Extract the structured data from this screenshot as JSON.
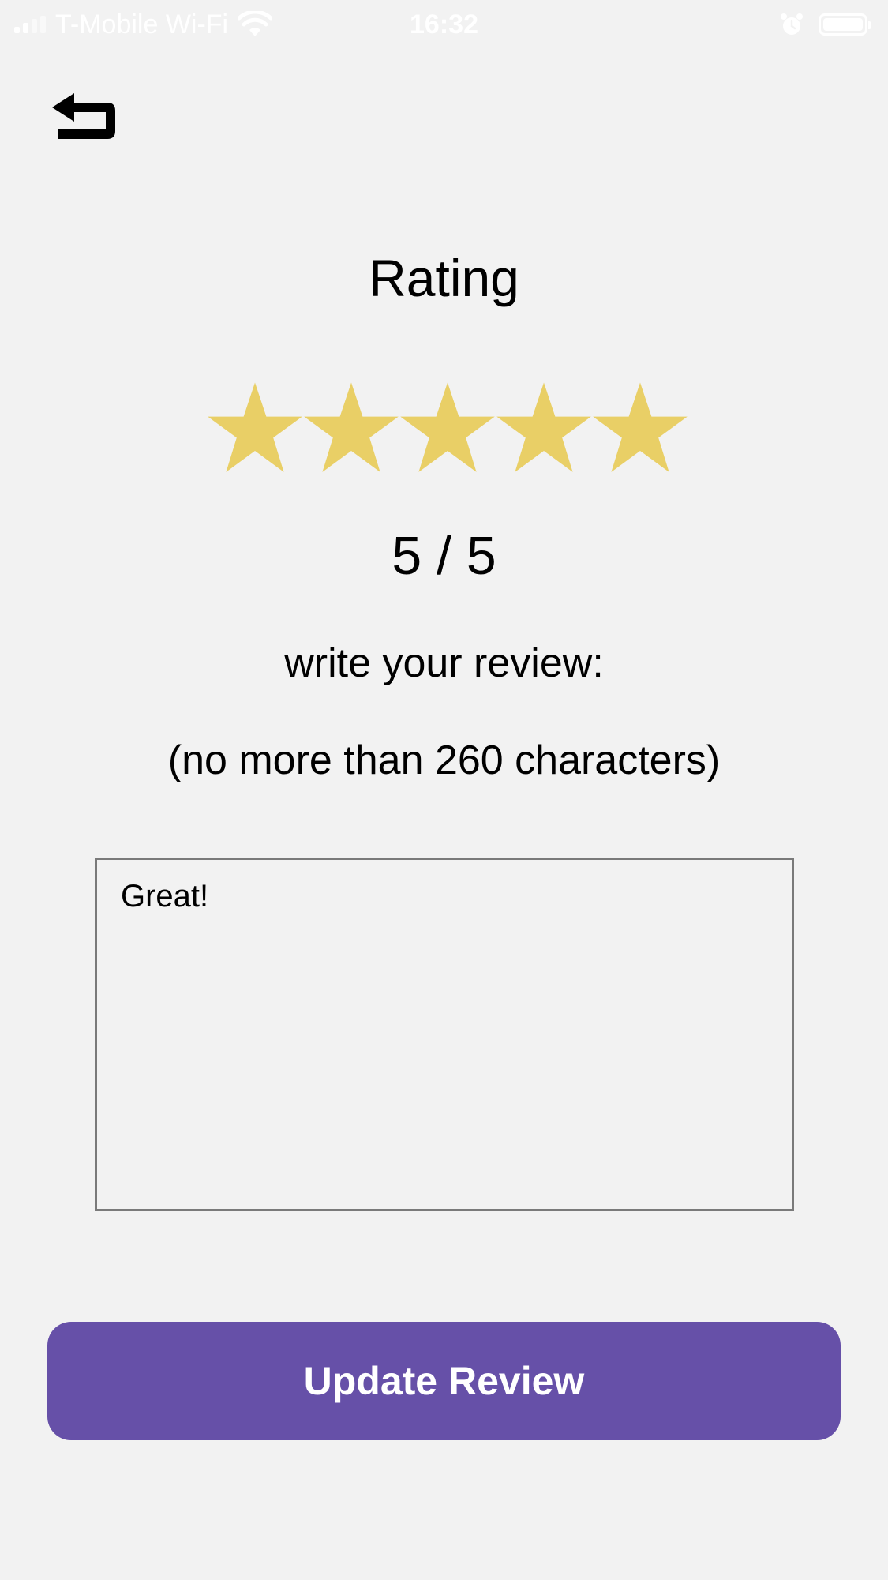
{
  "status_bar": {
    "carrier": "T-Mobile Wi-Fi",
    "time": "16:32",
    "signal_bars_filled": 2,
    "signal_bars_total": 4,
    "battery_level": 1.0
  },
  "header": {
    "back_icon": "return-arrow-icon"
  },
  "rating": {
    "title": "Rating",
    "value": 5,
    "max": 5,
    "score_text": "5 / 5",
    "star_color": "#e9cf66"
  },
  "review": {
    "prompt": "write your review:",
    "limit_note": "(no more than 260 characters)",
    "text": "Great!"
  },
  "actions": {
    "update_label": "Update Review",
    "update_color": "#6650a8"
  }
}
